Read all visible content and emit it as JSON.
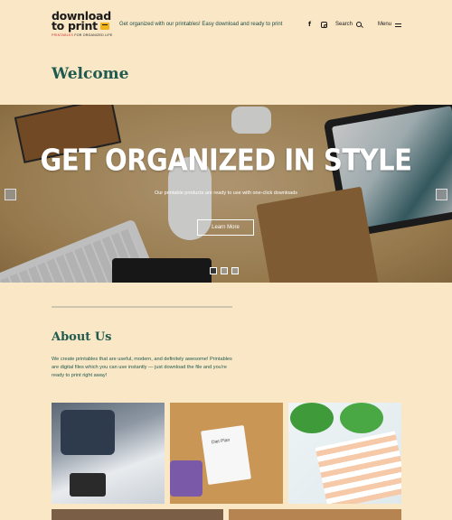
{
  "header": {
    "logo_line1": "download",
    "logo_line2": "to print",
    "logo_tag_highlight": "PRINTABLES",
    "logo_tag_rest": "FOR ORGANIZED LIFE",
    "tagline": "Get organized with our printables! Easy download and ready to print",
    "facebook_icon": "f",
    "search_label": "Search",
    "menu_label": "Menu"
  },
  "welcome": {
    "title": "Welcome"
  },
  "hero": {
    "title": "GET ORGANIZED IN STYLE",
    "subtitle": "Our printable products are ready to use with one-click downloads",
    "button_label": "Learn More",
    "slide_count": 3,
    "active_slide": 1
  },
  "about": {
    "title": "About Us",
    "body": "We create printables that are useful, modern, and definitely awesome! Printables are digital files which you can use instantly — just download the file and you're ready to print right away!"
  },
  "gallery": {
    "image2_label": "Diet Plan"
  }
}
